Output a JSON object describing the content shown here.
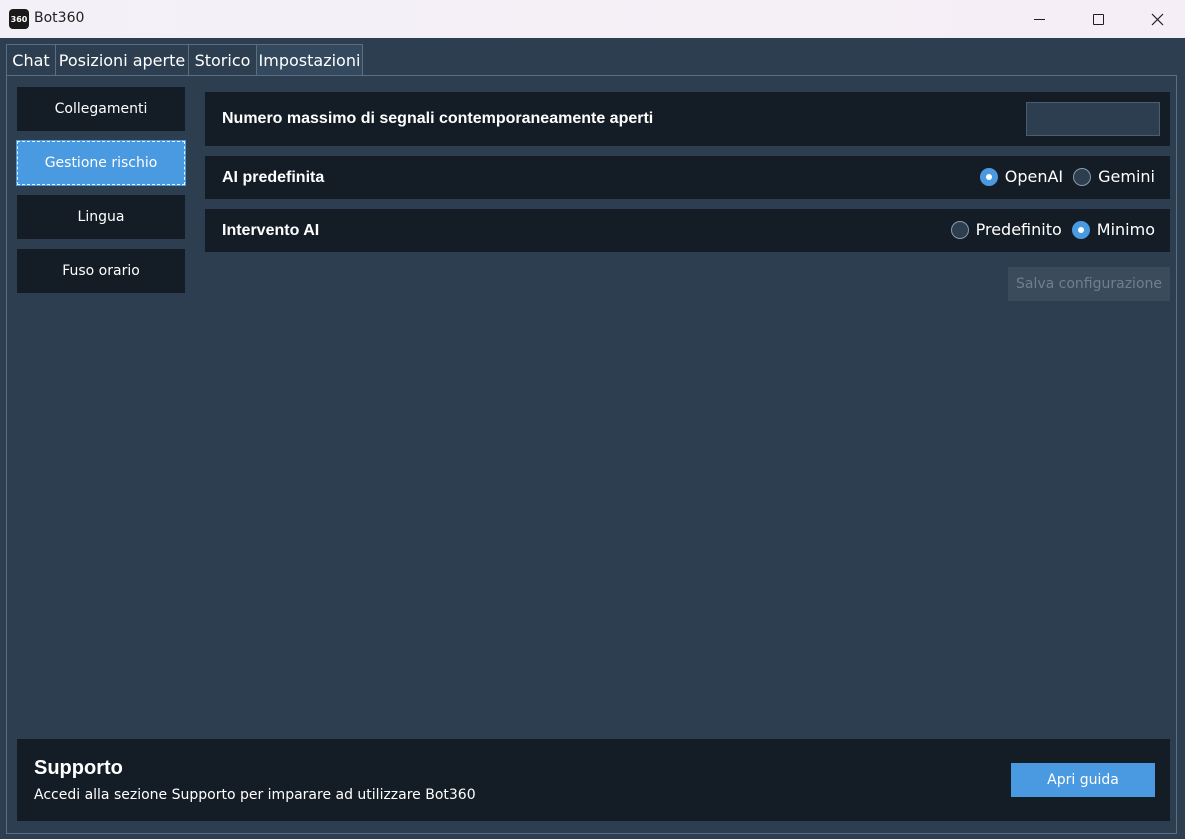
{
  "window": {
    "icon_text": "360",
    "title": "Bot360"
  },
  "tabs": [
    {
      "label": "Chat",
      "active": false
    },
    {
      "label": "Posizioni aperte",
      "active": false
    },
    {
      "label": "Storico",
      "active": false
    },
    {
      "label": "Impostazioni",
      "active": true
    }
  ],
  "sidebar": {
    "items": [
      {
        "label": "Collegamenti",
        "active": false
      },
      {
        "label": "Gestione rischio",
        "active": true
      },
      {
        "label": "Lingua",
        "active": false
      },
      {
        "label": "Fuso orario",
        "active": false
      }
    ]
  },
  "settings": {
    "max_signals": {
      "label": "Numero massimo di segnali contemporaneamente aperti",
      "value": ""
    },
    "default_ai": {
      "label": "AI predefinita",
      "options": [
        {
          "label": "OpenAI",
          "selected": true
        },
        {
          "label": "Gemini",
          "selected": false
        }
      ]
    },
    "ai_intervention": {
      "label": "Intervento AI",
      "options": [
        {
          "label": "Predefinito",
          "selected": false
        },
        {
          "label": "Minimo",
          "selected": true
        }
      ]
    },
    "save_label": "Salva configurazione"
  },
  "support": {
    "title": "Supporto",
    "description": "Accedi alla sezione Supporto per imparare ad utilizzare Bot360",
    "button_label": "Apri guida"
  },
  "colors": {
    "background": "#2c3e50",
    "panel": "#141d26",
    "accent": "#4a9ae1",
    "disabled_button": "#3b4b5c"
  }
}
